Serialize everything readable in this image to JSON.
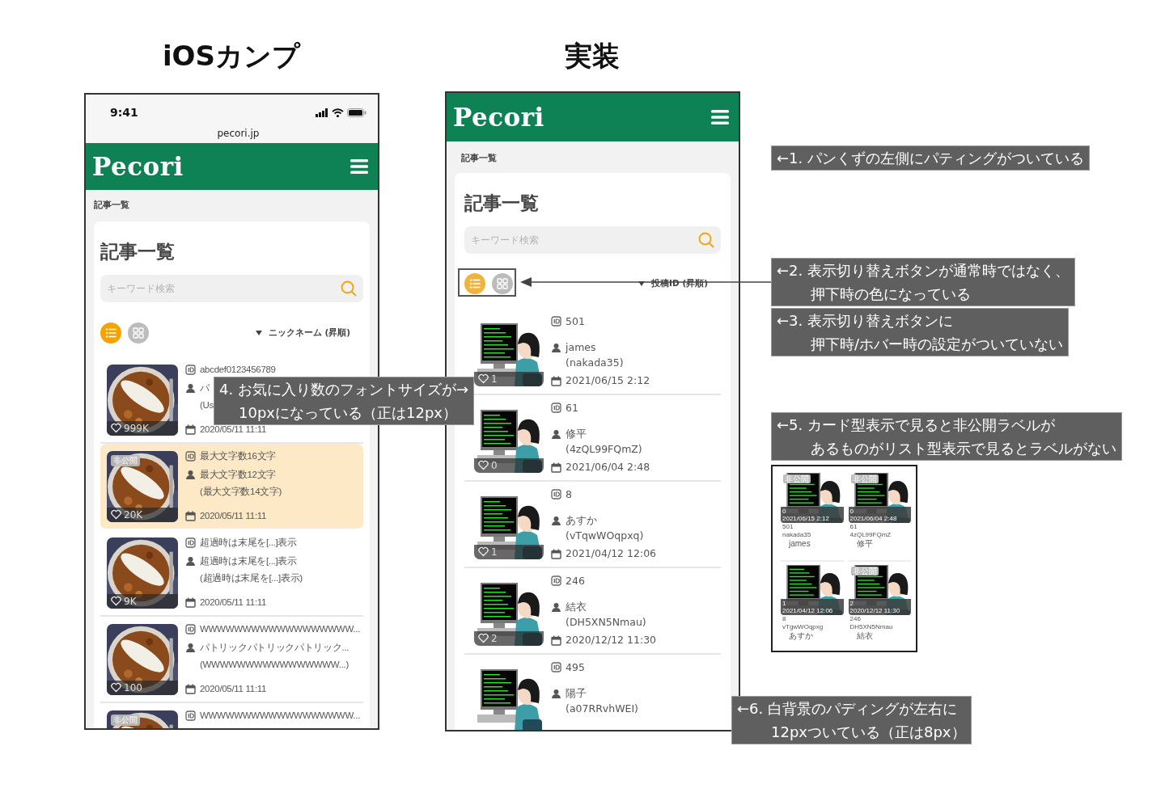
{
  "mockups": [
    {
      "heading": "iOSカンプ",
      "status_bar": {
        "time": "9:41"
      },
      "url": "pecori.jp",
      "logo": "Pecori",
      "breadcrumb": "記事一覧",
      "title": "記事一覧",
      "search": {
        "placeholder": "キーワード検索"
      },
      "view_toggles": [
        {
          "kind": "list",
          "selected": true
        },
        {
          "kind": "grid",
          "selected": false
        }
      ],
      "sort": "ニックネーム (昇順)",
      "posts": [
        {
          "id": "abcdef0123456789",
          "nickname": "パ",
          "account": "(Us",
          "date": "2020/05/11 11:11",
          "likes": "999K",
          "selected": false
        },
        {
          "id": "最大文字数16文字",
          "nickname": "最大文字数12文字",
          "account": "(最大文字数14文字)",
          "date": "2020/05/11 11:11",
          "likes": "20K",
          "label": "非公開",
          "selected": true
        },
        {
          "id": "超過時は末尾を[...]表示",
          "nickname": "超過時は末尾を[...]表示",
          "account": "(超過時は末尾を[...]表示)",
          "date": "2020/05/11 11:11",
          "likes": "9K",
          "selected": false
        },
        {
          "id": "WWWWWWWWWWWWWWWWWW...",
          "nickname": "パトリックパトリックパトリック...",
          "account": "(WWWWWWWWWWWWWWWW...)",
          "date": "2020/05/11 11:11",
          "likes": "100",
          "selected": false
        },
        {
          "id": "WWWWWWWWWWWWWWWWWW...",
          "label": "非公開",
          "selected": false
        }
      ]
    },
    {
      "heading": "実装",
      "logo": "Pecori",
      "breadcrumb": "記事一覧",
      "title": "記事一覧",
      "search": {
        "placeholder": "キーワード検索"
      },
      "view_toggles": [
        {
          "kind": "list",
          "selected": true
        },
        {
          "kind": "grid",
          "selected": false
        }
      ],
      "sort": "投稿ID (昇順)",
      "posts": [
        {
          "id": "501",
          "nickname": "james",
          "account": "(nakada35)",
          "date": "2021/06/15 2:12",
          "likes": "1",
          "selected": false
        },
        {
          "id": "61",
          "nickname": "修平",
          "account": "(4zQL99FQmZ)",
          "date": "2021/06/04 2:48",
          "likes": "0",
          "selected": false
        },
        {
          "id": "8",
          "nickname": "あすか",
          "account": "(vTqwWOqpxq)",
          "date": "2021/04/12 12:06",
          "likes": "1",
          "selected": false
        },
        {
          "id": "246",
          "nickname": "結衣",
          "account": "(DH5XN5Nmau)",
          "date": "2020/12/12 11:30",
          "likes": "2",
          "selected": false
        },
        {
          "id": "495",
          "nickname": "陽子",
          "account": "(a07RRvhWEI)",
          "selected": false
        }
      ]
    }
  ],
  "annotations": [
    {
      "lines": [
        "←1. パンくずの左側にパティングがついている"
      ]
    },
    {
      "lines": [
        "←2. 表示切り替えボタンが通常時ではなく、",
        "押下時の色になっている"
      ]
    },
    {
      "lines": [
        "←3. 表示切り替えボタンに",
        "押下時/ホバー時の設定がついていない"
      ]
    },
    {
      "lines": [
        "4. お気に入り数のフォントサイズが→",
        "10pxになっている（正は12px）"
      ]
    },
    {
      "lines": [
        "←5. カード型表示で見ると非公開ラベルが",
        "あるものがリスト型表示で見るとラベルがない"
      ]
    },
    {
      "lines": [
        "←6. 白背景のパディングが左右に",
        "12pxついている（正は8px）"
      ]
    }
  ],
  "card_view_inset": {
    "rows": [
      {
        "cards": [
          {
            "label": "非公開",
            "likes": "0",
            "date": "2021/06/15 2:12",
            "id": "501",
            "account": "nakada35",
            "nickname": "james"
          },
          {
            "label": "非公開",
            "likes": "0",
            "date": "2021/06/04 2:48",
            "id": "61",
            "account": "4zQL99FQmZ",
            "nickname": "修平"
          }
        ]
      },
      {
        "cards": [
          {
            "likes": "1",
            "date": "2021/04/12 12:06",
            "id": "8",
            "account": "vTgwWOqpxg",
            "nickname": "あすか"
          },
          {
            "label": "非公開",
            "likes": "2",
            "date": "2020/12/12 11:30",
            "id": "246",
            "account": "DH5XN5Nmau",
            "nickname": "結衣"
          }
        ]
      }
    ]
  }
}
